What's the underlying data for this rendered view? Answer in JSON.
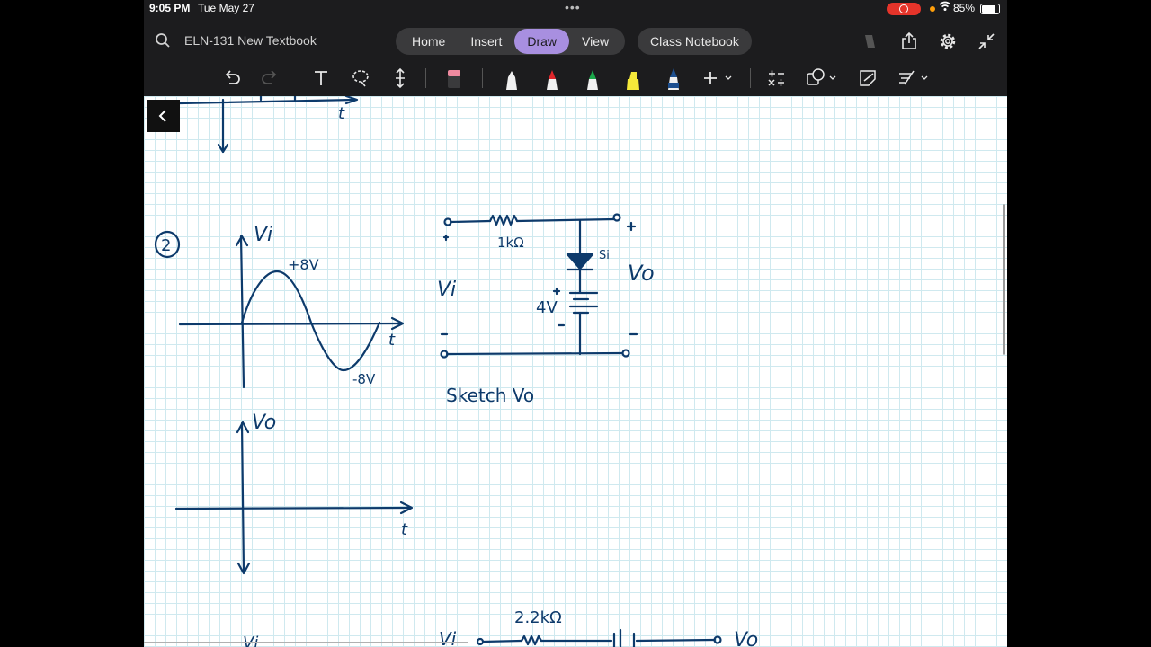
{
  "status_bar": {
    "time": "9:05 PM",
    "date": "Tue May 27",
    "battery_percent": "85%"
  },
  "header": {
    "notebook_title": "ELN-131 New Textbook",
    "tabs": [
      {
        "label": "Home"
      },
      {
        "label": "Insert"
      },
      {
        "label": "Draw"
      },
      {
        "label": "View"
      }
    ],
    "active_tab": "Draw",
    "class_notebook_label": "Class Notebook"
  },
  "colors": {
    "accent": "#a88fe0",
    "ink": "#0d3a6b",
    "grid": "#cfe9ef",
    "pens": [
      "#f0f0f0",
      "#e0262b",
      "#1aa84a",
      "#f5e93a",
      "#1d4f8f"
    ]
  },
  "icons": {
    "header_right": [
      "copilot-icon",
      "share-icon",
      "settings-icon",
      "collapse-icon"
    ],
    "toolbar": [
      "undo-icon",
      "redo-icon",
      "text-icon",
      "lasso-icon",
      "add-space-icon",
      "eraser-icon",
      "pen-white-icon",
      "pen-red-icon",
      "pen-green-icon",
      "highlighter-yellow-icon",
      "pen-blue-icon",
      "add-pen-icon",
      "math-icon",
      "shapes-icon",
      "ink-to-shape-icon",
      "ruler-icon"
    ]
  },
  "notes": {
    "problem_number": "2",
    "vi_label": "Vi",
    "peak_pos": "+8V",
    "peak_neg": "-8V",
    "t_label": "t",
    "resistor_label": "1kΩ",
    "diode_label": "Si",
    "battery_label": "4V",
    "vo_label": "Vo",
    "instruction": "Sketch Vo",
    "resistor2_label": "2.2kΩ"
  }
}
